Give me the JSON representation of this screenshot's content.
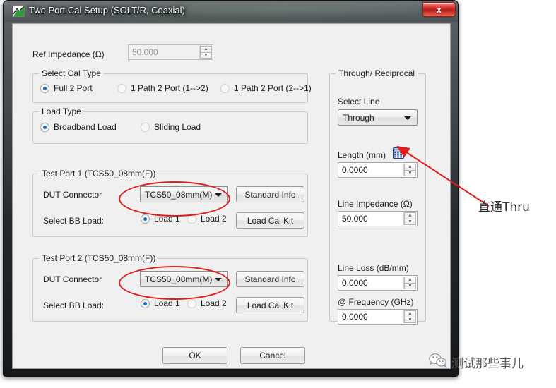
{
  "window": {
    "title": "Two Port Cal Setup (SOLT/R, Coaxial)",
    "icon": "trace-icon",
    "close_label": "x",
    "accent_red": "#b51f19"
  },
  "ref_impedance": {
    "label": "Ref Impedance (Ω)",
    "value": "50.000",
    "enabled": false
  },
  "cal_type": {
    "legend": "Select Cal Type",
    "options": [
      {
        "label": "Full 2 Port",
        "selected": true
      },
      {
        "label": "1 Path 2 Port (1-->2)",
        "selected": false
      },
      {
        "label": "1 Path 2 Port (2-->1)",
        "selected": false
      }
    ]
  },
  "load_type": {
    "legend": "Load Type",
    "options": [
      {
        "label": "Broadband Load",
        "selected": true
      },
      {
        "label": "Sliding Load",
        "selected": false
      }
    ]
  },
  "test_port_1": {
    "legend": "Test Port 1 (TCS50_08mm(F))",
    "dut_connector_label": "DUT Connector",
    "dut_connector_value": "TCS50_08mm(M)",
    "standard_info_label": "Standard Info",
    "bb_load_label": "Select BB Load:",
    "bb_load_options": [
      {
        "label": "Load 1",
        "selected": true
      },
      {
        "label": "Load 2",
        "selected": false
      }
    ],
    "load_cal_kit_label": "Load Cal Kit"
  },
  "test_port_2": {
    "legend": "Test Port 2 (TCS50_08mm(F))",
    "dut_connector_label": "DUT Connector",
    "dut_connector_value": "TCS50_08mm(M)",
    "standard_info_label": "Standard Info",
    "bb_load_label": "Select BB Load:",
    "bb_load_options": [
      {
        "label": "Load 1",
        "selected": true
      },
      {
        "label": "Load 2",
        "selected": false
      }
    ],
    "load_cal_kit_label": "Load Cal Kit"
  },
  "through_reciprocal": {
    "legend": "Through/ Reciprocal",
    "select_line_label": "Select Line",
    "select_line_value": "Through",
    "length_label": "Length (mm)",
    "length_calc_icon": "calculator-icon",
    "length_value": "0.0000",
    "line_impedance_label": "Line Impedance (Ω)",
    "line_impedance_value": "50.000",
    "line_loss_label": "Line Loss (dB/mm)",
    "line_loss_value": "0.0000",
    "frequency_label": "@ Frequency (GHz)",
    "frequency_value": "0.0000"
  },
  "footer": {
    "ok_label": "OK",
    "cancel_label": "Cancel"
  },
  "annotations": {
    "color": "#e01b1b",
    "thru_note": "直通Thru",
    "watermark_text": "测试那些事儿",
    "watermark_icon": "wechat-icon"
  }
}
